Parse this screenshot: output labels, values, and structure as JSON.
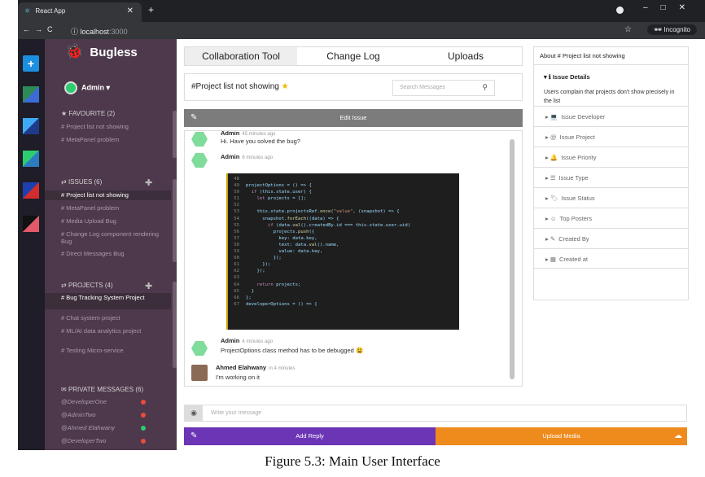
{
  "browser": {
    "tab_title": "React App",
    "url_host": "localhost",
    "url_port": ":3000",
    "incognito_label": "Incognito"
  },
  "sidebar": {
    "brand": "Bugless",
    "user": "Admin",
    "favourite_header": "FAVOURITE (2)",
    "favourites": [
      "# Project list not showing",
      "# MetaPanel problem"
    ],
    "issues_header": "ISSUES (6)",
    "issues": [
      "# Project list not showing",
      "# MetaPanel problem",
      "# Media Upload Bug",
      "# Change Log component rendering Bug",
      "# Direct Messages Bug"
    ],
    "projects_header": "PROJECTS (4)",
    "projects": [
      "# Bug Tracking System Project",
      "# Chat system project",
      "# ML/AI data analytics project",
      "# Testing Micro-service"
    ],
    "pm_header": "PRIVATE MESSAGES (6)",
    "private_messages": [
      {
        "name": "@DeveloperOne",
        "status": "#e74c3c"
      },
      {
        "name": "@AdminTwo",
        "status": "#e74c3c"
      },
      {
        "name": "@Ahmed Elahwany",
        "status": "#2ecc71"
      },
      {
        "name": "@DeveloperTwo",
        "status": "#e74c3c"
      }
    ]
  },
  "main": {
    "tabs": [
      "Collaboration Tool",
      "Change Log",
      "Uploads"
    ],
    "issue_title": "#Project list not showing",
    "search_placeholder": "Search Messages",
    "edit_label": "Edit Issue",
    "messages": [
      {
        "name": "Admin",
        "time": "45 minutes ago",
        "text": "Hi. Have you solved the bug?"
      },
      {
        "name": "Admin",
        "time": "6 minutes ago",
        "text": ""
      },
      {
        "name": "Admin",
        "time": "4 minutes ago",
        "text": "ProjectOptions class method has to be debugged 😩"
      },
      {
        "name": "Ahmed Elahwany",
        "time": "in 4 minutes",
        "text": "I'm working on it"
      }
    ],
    "message_placeholder": "Write your message",
    "reply_label": "Add Reply",
    "upload_label": "Upload Media"
  },
  "right": {
    "about": "About # Project list not showing",
    "details_header": "Issue Details",
    "details_text": "Users complain that projects don't show precisely in the list",
    "sections": [
      "Issue Developer",
      "Issue Project",
      "Issue Priority",
      "Issue Type",
      "Issue Status",
      "Top Posters",
      "Created By",
      "Created at"
    ]
  },
  "caption": "Figure 5.3: Main User Interface",
  "colors": {
    "sidebar": "#4d394b",
    "reply_button": "#6b35b5",
    "upload_button": "#ef8a1d",
    "add_button": "#1c8fe0"
  }
}
